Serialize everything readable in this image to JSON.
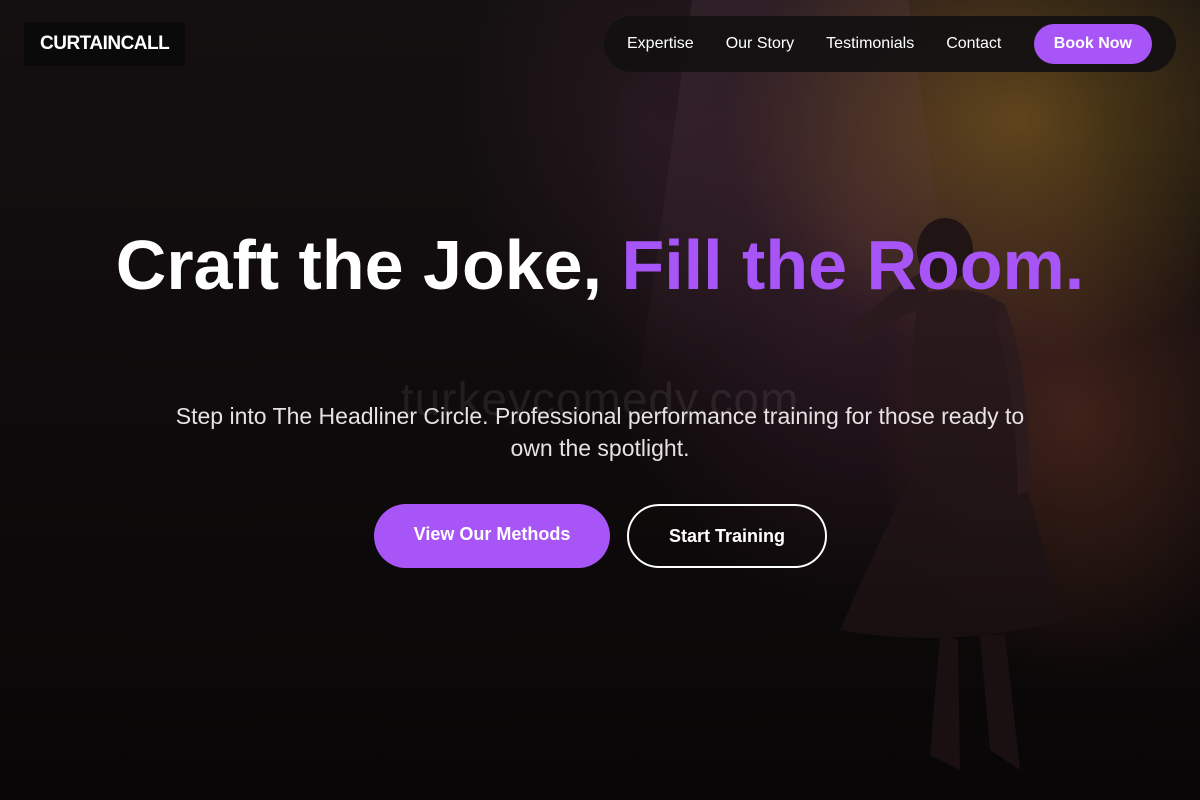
{
  "header": {
    "logo": "CURTAINCALL",
    "nav": [
      {
        "label": "Expertise"
      },
      {
        "label": "Our Story"
      },
      {
        "label": "Testimonials"
      },
      {
        "label": "Contact"
      }
    ],
    "cta_label": "Book Now"
  },
  "hero": {
    "title_main": "Craft the Joke, ",
    "title_accent": "Fill the Room.",
    "subtitle": "Step into The Headliner Circle. Professional performance training for those ready to own the spotlight.",
    "watermark": "turkeycomedy.com",
    "primary_button": "View Our Methods",
    "secondary_button": "Start Training"
  },
  "colors": {
    "accent": "#a855f7",
    "background": "#0b0708"
  }
}
